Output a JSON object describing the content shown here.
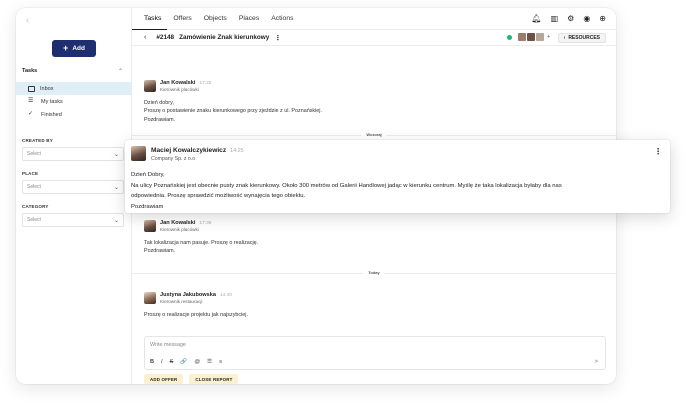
{
  "sidebar": {
    "collapse_glyph": "‹",
    "add_label": "Add",
    "tasks_title": "Tasks",
    "nav": [
      {
        "label": "Inbox",
        "icon": "inbox-icon"
      },
      {
        "label": "My tasks",
        "icon": "list-icon"
      },
      {
        "label": "Finished",
        "icon": "check-icon"
      }
    ],
    "filters": [
      {
        "label": "CREATED BY",
        "value": "Select"
      },
      {
        "label": "PLACE",
        "value": "Select"
      },
      {
        "label": "CATEGORY",
        "value": "Select"
      }
    ]
  },
  "topnav": {
    "tabs": [
      "Tasks",
      "Offers",
      "Objects",
      "Places",
      "Actions"
    ],
    "active_tab": "Tasks",
    "icons": [
      "bell-icon",
      "map-icon",
      "settings-icon",
      "user-icon",
      "globe-icon"
    ]
  },
  "ticket": {
    "number": "#2148",
    "title": "Zamówienie Znak kierunkowy",
    "status_color": "#22b573",
    "participants_more": "+",
    "resources_label": "RESOURCES"
  },
  "messages": [
    {
      "author": "Jan Kowalski",
      "time": "17:25",
      "role": "Kierownik placówki",
      "lines": [
        "Dzień dobry,",
        "Proszę o postawienie znaku kierunkowego przy zjeździe z ul. Poznańskiej.",
        "Pozdrawiam."
      ]
    },
    {
      "author": "Maciej Kowalczykiewicz",
      "time": "14:25",
      "role": "Company Sp. z o.o",
      "lines": [
        "Dzień Dobry,",
        "Na ulicy Poznańskiej jest obecnie pusty znak kierunkowy. Około 300 metrów od Galerii Handlowej jadąc w kierunku centrum. Myślę że taka lokalizacja byłaby dla nas",
        "odpowiednia. Proszę sprawdzić możliwość wynajęcia tego obiektu.",
        "Pozdrawiam"
      ]
    },
    {
      "author": "Jan Kowalski",
      "time": "17:36",
      "role": "Kierownik placówki",
      "lines": [
        "Tak lokalizacja nam pasuje. Proszę o realizację.",
        "Pozdrawiam."
      ]
    },
    {
      "author": "Justyna Jakubowska",
      "time": "14:40",
      "role": "Kierownik restauracji",
      "lines": [
        "Proszę o realizacje projektu jak najszybciej."
      ]
    }
  ],
  "dividers": {
    "yesterday": "Wczoraj",
    "today": "Today"
  },
  "composer": {
    "placeholder": "Write message",
    "tools": [
      "B",
      "I",
      "S",
      "🔗",
      "@",
      "☰",
      "≡"
    ],
    "send_glyph": "➤"
  },
  "actions": {
    "add_offer": "ADD OFFER",
    "close_report": "CLOSE REPORT"
  }
}
